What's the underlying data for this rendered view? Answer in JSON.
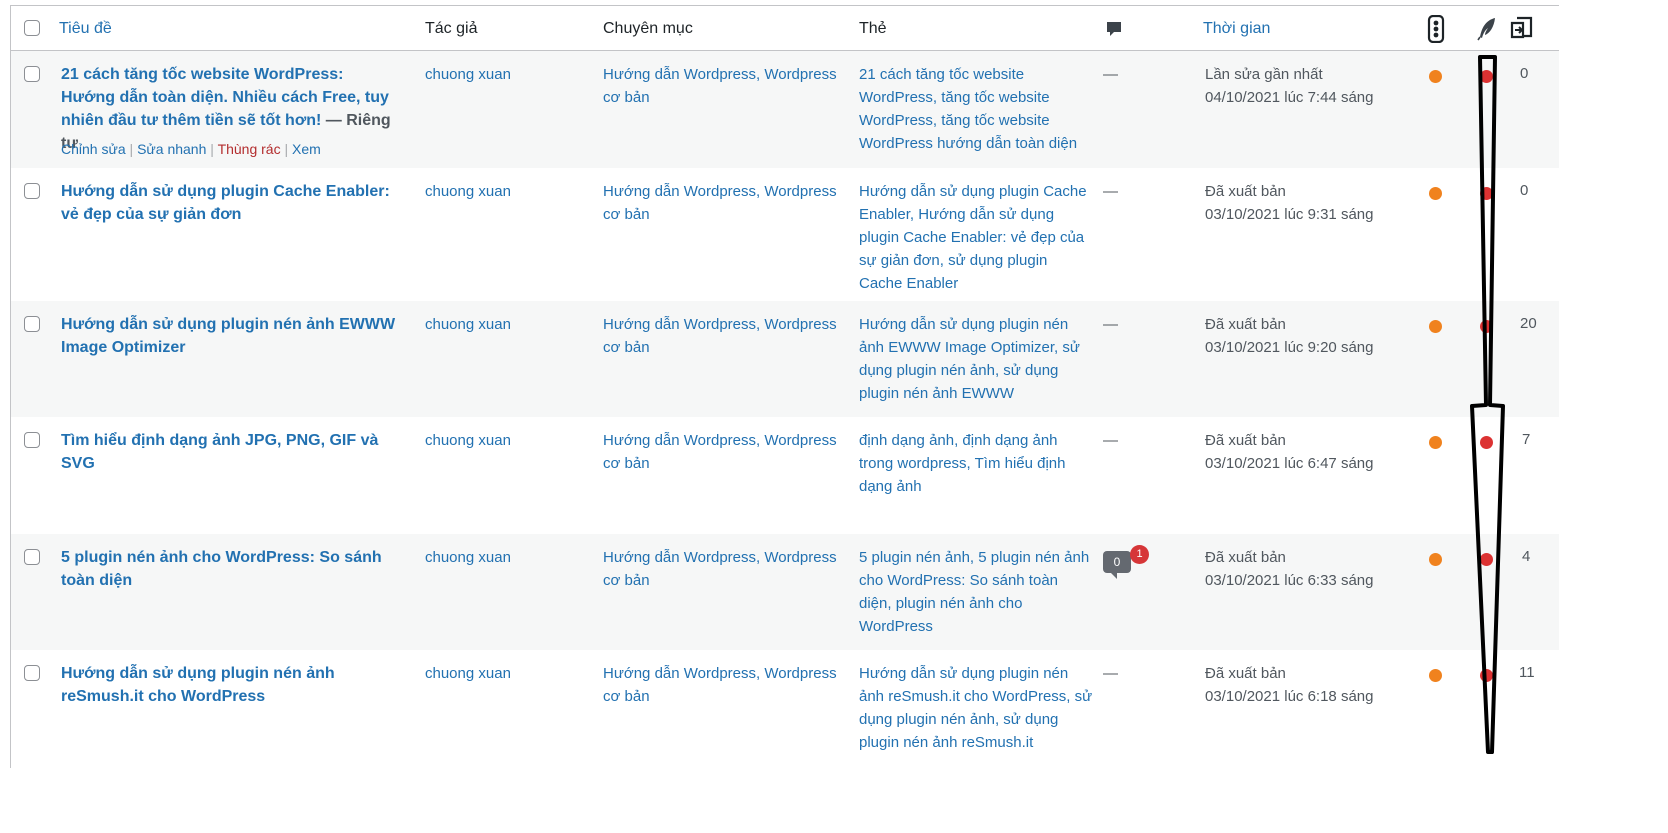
{
  "headers": {
    "title": "Tiêu đề",
    "author": "Tác giả",
    "categories": "Chuyên mục",
    "tags": "Thẻ",
    "comments_icon": "comment-bubble-icon",
    "date": "Thời gian",
    "seo_icon": "traffic-light-icon",
    "readability_icon": "feather-icon",
    "links_icon": "internal-links-icon"
  },
  "row_actions": {
    "edit": "Chỉnh sửa",
    "quick_edit": "Sửa nhanh",
    "trash": "Thùng rác",
    "view": "Xem",
    "separator": "|"
  },
  "colors": {
    "link": "#2271b1",
    "seo_dot": "#f0821e",
    "readability_dot": "#dc3232",
    "pending_badge": "#d63638"
  },
  "posts": [
    {
      "title": "21 cách tăng tốc website WordPress: Hướng dẫn toàn diện. Nhiều cách Free, tuy nhiên đầu tư thêm tiền sẽ tốt hơn!",
      "state": " — Riêng tư",
      "author": "chuong xuan",
      "categories": "Hướng dẫn Wordpress, Wordpress cơ bản",
      "tags": "21 cách tăng tốc website WordPress, tăng tốc website WordPress, tăng tốc website WordPress hướng dẫn toàn diện",
      "comments": "—",
      "date_status": "Lần sửa gần nhất",
      "date": "04/10/2021 lúc 7:44 sáng",
      "links": "0"
    },
    {
      "title": "Hướng dẫn sử dụng plugin Cache Enabler: vẻ đẹp của sự giản đơn",
      "state": "",
      "author": "chuong xuan",
      "categories": "Hướng dẫn Wordpress, Wordpress cơ bản",
      "tags": "Hướng dẫn sử dụng plugin Cache Enabler, Hướng dẫn sử dụng plugin Cache Enabler: vẻ đẹp của sự giản đơn, sử dụng plugin Cache Enabler",
      "comments": "—",
      "date_status": "Đã xuất bản",
      "date": "03/10/2021 lúc 9:31 sáng",
      "links": "0"
    },
    {
      "title": "Hướng dẫn sử dụng plugin nén ảnh EWWW Image Optimizer",
      "state": "",
      "author": "chuong xuan",
      "categories": "Hướng dẫn Wordpress, Wordpress cơ bản",
      "tags": "Hướng dẫn sử dụng plugin nén ảnh EWWW Image Optimizer, sử dụng plugin nén ảnh, sử dụng plugin nén ảnh EWWW",
      "comments": "—",
      "date_status": "Đã xuất bản",
      "date": "03/10/2021 lúc 9:20 sáng",
      "links": "20"
    },
    {
      "title": "Tìm hiểu định dạng ảnh JPG, PNG, GIF và SVG",
      "state": "",
      "author": "chuong xuan",
      "categories": "Hướng dẫn Wordpress, Wordpress cơ bản",
      "tags": "định dạng ảnh, định dạng ảnh trong wordpress, Tìm hiểu định dạng ảnh",
      "comments": "—",
      "date_status": "Đã xuất bản",
      "date": "03/10/2021 lúc 6:47 sáng",
      "links": "7"
    },
    {
      "title": "5 plugin nén ảnh cho WordPress: So sánh toàn diện",
      "state": "",
      "author": "chuong xuan",
      "categories": "Hướng dẫn Wordpress, Wordpress cơ bản",
      "tags": "5 plugin nén ảnh, 5 plugin nén ảnh cho WordPress: So sánh toàn diện, plugin nén ảnh cho WordPress",
      "comments": "",
      "comment_count": "0",
      "pending_count": "1",
      "date_status": "Đã xuất bản",
      "date": "03/10/2021 lúc 6:33 sáng",
      "links": "4"
    },
    {
      "title": "Hướng dẫn sử dụng plugin nén ảnh reSmush.it cho WordPress",
      "state": "",
      "author": "chuong xuan",
      "categories": "Hướng dẫn Wordpress, Wordpress cơ bản",
      "tags": "Hướng dẫn sử dụng plugin nén ảnh reSmush.it cho WordPress, sử dụng plugin nén ảnh, sử dụng plugin nén ảnh reSmush.it",
      "comments": "—",
      "date_status": "Đã xuất bản",
      "date": "03/10/2021 lúc 6:18 sáng",
      "links": "11"
    }
  ]
}
